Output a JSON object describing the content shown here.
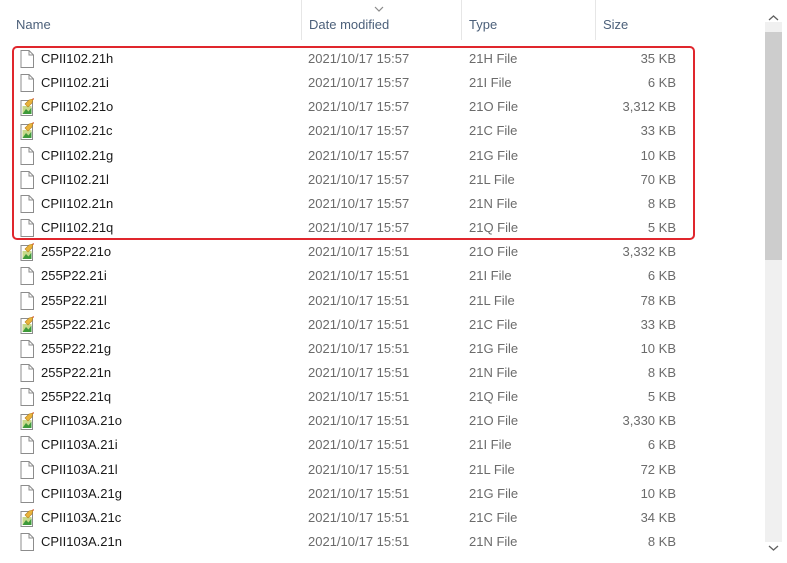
{
  "columns": {
    "name": "Name",
    "date": "Date modified",
    "type": "Type",
    "size": "Size"
  },
  "files": [
    {
      "name": "CPII102.21h",
      "date": "2021/10/17 15:57",
      "type": "21H File",
      "size": "35 KB",
      "icon": "blank-file-icon"
    },
    {
      "name": "CPII102.21i",
      "date": "2021/10/17 15:57",
      "type": "21I File",
      "size": "6 KB",
      "icon": "blank-file-icon"
    },
    {
      "name": "CPII102.21o",
      "date": "2021/10/17 15:57",
      "type": "21O File",
      "size": "3,312 KB",
      "icon": "image-file-icon"
    },
    {
      "name": "CPII102.21c",
      "date": "2021/10/17 15:57",
      "type": "21C File",
      "size": "33 KB",
      "icon": "image-file-icon"
    },
    {
      "name": "CPII102.21g",
      "date": "2021/10/17 15:57",
      "type": "21G File",
      "size": "10 KB",
      "icon": "blank-file-icon"
    },
    {
      "name": "CPII102.21l",
      "date": "2021/10/17 15:57",
      "type": "21L File",
      "size": "70 KB",
      "icon": "blank-file-icon"
    },
    {
      "name": "CPII102.21n",
      "date": "2021/10/17 15:57",
      "type": "21N File",
      "size": "8 KB",
      "icon": "blank-file-icon"
    },
    {
      "name": "CPII102.21q",
      "date": "2021/10/17 15:57",
      "type": "21Q File",
      "size": "5 KB",
      "icon": "blank-file-icon"
    },
    {
      "name": "255P22.21o",
      "date": "2021/10/17 15:51",
      "type": "21O File",
      "size": "3,332 KB",
      "icon": "image-file-icon"
    },
    {
      "name": "255P22.21i",
      "date": "2021/10/17 15:51",
      "type": "21I File",
      "size": "6 KB",
      "icon": "blank-file-icon"
    },
    {
      "name": "255P22.21l",
      "date": "2021/10/17 15:51",
      "type": "21L File",
      "size": "78 KB",
      "icon": "blank-file-icon"
    },
    {
      "name": "255P22.21c",
      "date": "2021/10/17 15:51",
      "type": "21C File",
      "size": "33 KB",
      "icon": "image-file-icon"
    },
    {
      "name": "255P22.21g",
      "date": "2021/10/17 15:51",
      "type": "21G File",
      "size": "10 KB",
      "icon": "blank-file-icon"
    },
    {
      "name": "255P22.21n",
      "date": "2021/10/17 15:51",
      "type": "21N File",
      "size": "8 KB",
      "icon": "blank-file-icon"
    },
    {
      "name": "255P22.21q",
      "date": "2021/10/17 15:51",
      "type": "21Q File",
      "size": "5 KB",
      "icon": "blank-file-icon"
    },
    {
      "name": "CPII103A.21o",
      "date": "2021/10/17 15:51",
      "type": "21O File",
      "size": "3,330 KB",
      "icon": "image-file-icon"
    },
    {
      "name": "CPII103A.21i",
      "date": "2021/10/17 15:51",
      "type": "21I File",
      "size": "6 KB",
      "icon": "blank-file-icon"
    },
    {
      "name": "CPII103A.21l",
      "date": "2021/10/17 15:51",
      "type": "21L File",
      "size": "72 KB",
      "icon": "blank-file-icon"
    },
    {
      "name": "CPII103A.21g",
      "date": "2021/10/17 15:51",
      "type": "21G File",
      "size": "10 KB",
      "icon": "blank-file-icon"
    },
    {
      "name": "CPII103A.21c",
      "date": "2021/10/17 15:51",
      "type": "21C File",
      "size": "34 KB",
      "icon": "image-file-icon"
    },
    {
      "name": "CPII103A.21n",
      "date": "2021/10/17 15:51",
      "type": "21N File",
      "size": "8 KB",
      "icon": "blank-file-icon"
    }
  ],
  "highlight_color": "#e0262d",
  "scroll_position": 0.0
}
